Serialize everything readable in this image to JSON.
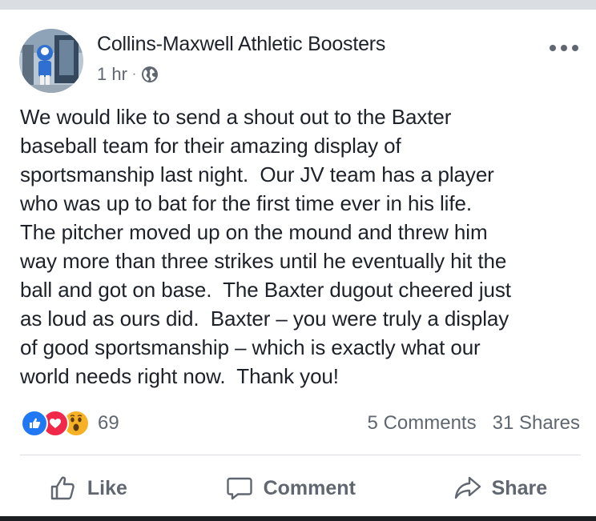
{
  "post": {
    "author": "Collins-Maxwell Athletic Boosters",
    "time": "1 hr",
    "separator": "·",
    "privacy_icon": "globe-icon",
    "more_icon": "more-options-icon",
    "body_lines": [
      "We would like to send a shout out to the Baxter",
      "baseball team for their amazing display of",
      "sportsmanship last night.  Our JV team has a player",
      "who was up to bat for the first time ever in his life.",
      "The pitcher moved up on the mound and threw him",
      "way more than three strikes until he eventually hit the",
      "ball and got on base.  The Baxter dugout cheered just",
      "as loud as ours did.  Baxter – you were truly a display",
      "of good sportsmanship – which is exactly what our",
      "world needs right now.  Thank you!"
    ]
  },
  "engagement": {
    "reaction_icons": [
      "like-reaction-icon",
      "love-reaction-icon",
      "wow-reaction-icon"
    ],
    "reaction_count": "69",
    "comments": "5 Comments",
    "shares": "31 Shares"
  },
  "actions": {
    "like": "Like",
    "comment": "Comment",
    "share": "Share"
  },
  "colors": {
    "like_blue": "#2078f4",
    "love_red": "#f0284a",
    "wow_yellow": "#f7b125",
    "text_gray": "#606770",
    "text_dark": "#1d2129"
  }
}
